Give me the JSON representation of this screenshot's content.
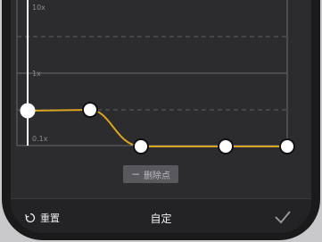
{
  "curve": {
    "scale_labels": [
      "10x",
      "1x",
      "0.1x"
    ],
    "line_color": "#d9a521",
    "point_color": "#ffffff",
    "point_count": 6
  },
  "actions": {
    "delete_point_label": "删除点"
  },
  "toolbar": {
    "reset_label": "重置",
    "title": "自定",
    "confirm_icon": "checkmark-icon"
  },
  "colors": {
    "background": "#2c2c2e",
    "accent": "#d9a521"
  }
}
